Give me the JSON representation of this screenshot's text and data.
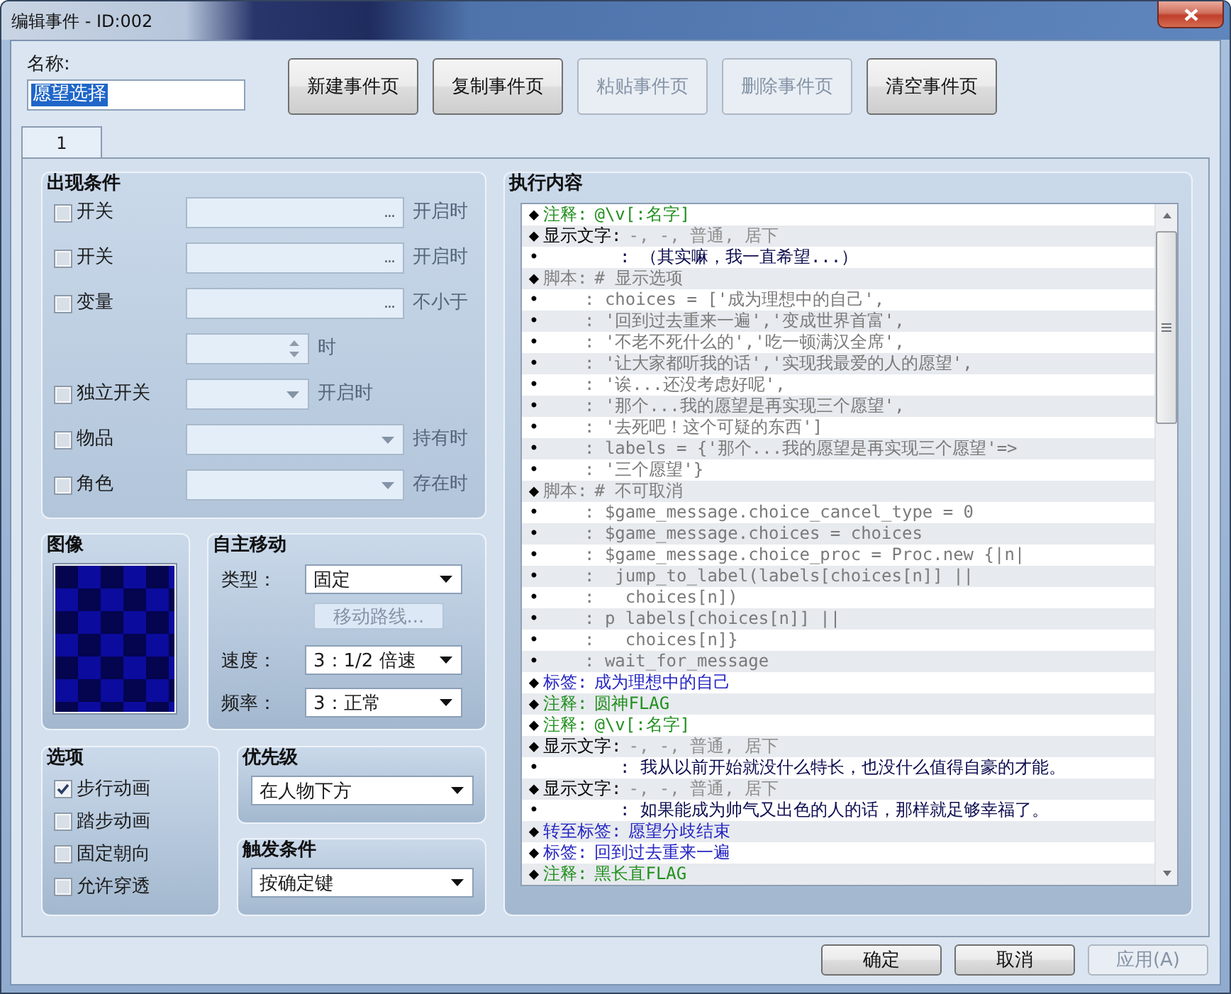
{
  "window": {
    "title": "编辑事件 - ID:002"
  },
  "name_field": {
    "label": "名称:",
    "value": "愿望选择",
    "value_selected": true
  },
  "page_buttons": [
    {
      "label": "新建事件页",
      "disabled": false
    },
    {
      "label": "复制事件页",
      "disabled": false
    },
    {
      "label": "粘贴事件页",
      "disabled": true
    },
    {
      "label": "删除事件页",
      "disabled": true
    },
    {
      "label": "清空事件页",
      "disabled": false
    }
  ],
  "tabs": [
    {
      "label": "1",
      "selected": true
    }
  ],
  "conditions": {
    "title": "出现条件",
    "items": [
      {
        "kind": "picker",
        "label": "开关",
        "checked": false,
        "button": "...",
        "suffix": "开启时"
      },
      {
        "kind": "picker",
        "label": "开关",
        "checked": false,
        "button": "...",
        "suffix": "开启时"
      },
      {
        "kind": "variable",
        "label": "变量",
        "checked": false,
        "button": "...",
        "suffix": "不小于",
        "spin_suffix": "时"
      },
      {
        "kind": "short_dropdown",
        "label": "独立开关",
        "checked": false,
        "suffix": "开启时"
      },
      {
        "kind": "dropdown",
        "label": "物品",
        "checked": false,
        "suffix": "持有时"
      },
      {
        "kind": "dropdown",
        "label": "角色",
        "checked": false,
        "suffix": "存在时"
      }
    ]
  },
  "graphic": {
    "title": "图像"
  },
  "movement": {
    "title": "自主移动",
    "type": {
      "label": "类型：",
      "value": "固定"
    },
    "route_button": {
      "label": "移动路线...",
      "disabled": true
    },
    "speed": {
      "label": "速度：",
      "value": "3：1/2 倍速"
    },
    "frequency": {
      "label": "频率：",
      "value": "3：正常"
    }
  },
  "options": {
    "title": "选项",
    "items": [
      {
        "label": "步行动画",
        "checked": true
      },
      {
        "label": "踏步动画",
        "checked": false
      },
      {
        "label": "固定朝向",
        "checked": false
      },
      {
        "label": "允许穿透",
        "checked": false
      }
    ]
  },
  "priority": {
    "title": "优先级",
    "value": "在人物下方"
  },
  "trigger": {
    "title": "触发条件",
    "value": "按确定键"
  },
  "contents": {
    "title": "执行内容",
    "rows": [
      {
        "kind": "comment",
        "marker": "◆",
        "command": "注释:",
        "text": "@\\v[:名字]"
      },
      {
        "kind": "message",
        "marker": "◆",
        "command": "显示文字:",
        "text": "-, -, 普通, 居下"
      },
      {
        "kind": "message_line",
        "marker": "•",
        "text": ": （其实嘛，我一直希望...）"
      },
      {
        "kind": "script",
        "marker": "◆",
        "command": "脚本:",
        "text": "# 显示选项"
      },
      {
        "kind": "script_line",
        "marker": "•",
        "text": ": choices = ['成为理想中的自己',"
      },
      {
        "kind": "script_line",
        "marker": "•",
        "text": ": '回到过去重来一遍','变成世界首富',"
      },
      {
        "kind": "script_line",
        "marker": "•",
        "text": ": '不老不死什么的','吃一顿满汉全席',"
      },
      {
        "kind": "script_line",
        "marker": "•",
        "text": ": '让大家都听我的话','实现我最爱的人的愿望',"
      },
      {
        "kind": "script_line",
        "marker": "•",
        "text": ": '诶...还没考虑好呢',"
      },
      {
        "kind": "script_line",
        "marker": "•",
        "text": ": '那个...我的愿望是再实现三个愿望',"
      },
      {
        "kind": "script_line",
        "marker": "•",
        "text": ": '去死吧！这个可疑的东西']"
      },
      {
        "kind": "script_line",
        "marker": "•",
        "text": ": labels = {'那个...我的愿望是再实现三个愿望'=>"
      },
      {
        "kind": "script_line",
        "marker": "•",
        "text": ": '三个愿望'}"
      },
      {
        "kind": "script",
        "marker": "◆",
        "command": "脚本:",
        "text": "# 不可取消"
      },
      {
        "kind": "script_line",
        "marker": "•",
        "text": ": $game_message.choice_cancel_type = 0"
      },
      {
        "kind": "script_line",
        "marker": "•",
        "text": ": $game_message.choices = choices"
      },
      {
        "kind": "script_line",
        "marker": "•",
        "text": ": $game_message.choice_proc = Proc.new {|n|"
      },
      {
        "kind": "script_line",
        "marker": "•",
        "text": ":  jump_to_label(labels[choices[n]] ||"
      },
      {
        "kind": "script_line",
        "marker": "•",
        "text": ":   choices[n])"
      },
      {
        "kind": "script_line",
        "marker": "•",
        "text": ": p labels[choices[n]] ||"
      },
      {
        "kind": "script_line",
        "marker": "•",
        "text": ":   choices[n]}"
      },
      {
        "kind": "script_line",
        "marker": "•",
        "text": ": wait_for_message"
      },
      {
        "kind": "label",
        "marker": "◆",
        "command": "标签:",
        "text": "成为理想中的自己"
      },
      {
        "kind": "comment",
        "marker": "◆",
        "command": "注释:",
        "text": "圆神FLAG"
      },
      {
        "kind": "comment",
        "marker": "◆",
        "command": "注释:",
        "text": "@\\v[:名字]"
      },
      {
        "kind": "message",
        "marker": "◆",
        "command": "显示文字:",
        "text": "-, -, 普通, 居下"
      },
      {
        "kind": "message_line",
        "marker": "•",
        "text": ": 我从以前开始就没什么特长，也没什么值得自豪的才能。"
      },
      {
        "kind": "message",
        "marker": "◆",
        "command": "显示文字:",
        "text": "-, -, 普通, 居下"
      },
      {
        "kind": "message_line",
        "marker": "•",
        "text": ": 如果能成为帅气又出色的人的话，那样就足够幸福了。"
      },
      {
        "kind": "jump",
        "marker": "◆",
        "command": "转至标签:",
        "text": "愿望分歧结束"
      },
      {
        "kind": "label",
        "marker": "◆",
        "command": "标签:",
        "text": "回到过去重来一遍"
      },
      {
        "kind": "comment",
        "marker": "◆",
        "command": "注释:",
        "text": "黑长直FLAG"
      }
    ]
  },
  "dialog_buttons": [
    {
      "label": "确定",
      "disabled": false
    },
    {
      "label": "取消",
      "disabled": false
    },
    {
      "label": "应用(A)",
      "disabled": true
    }
  ]
}
